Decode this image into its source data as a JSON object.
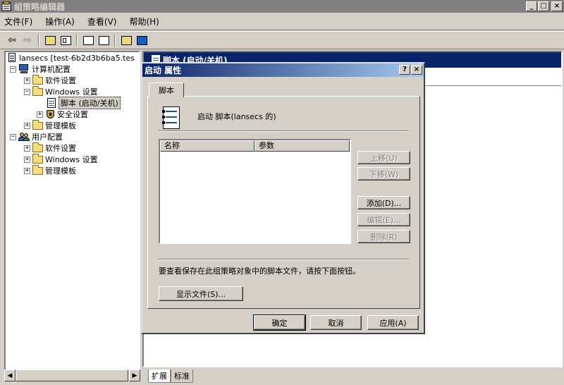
{
  "window": {
    "title": "組策略编辑器",
    "min": "_",
    "max": "□",
    "close": "×"
  },
  "menu": [
    "文件(F)",
    "操作(A)",
    "查看(V)",
    "帮助(H)"
  ],
  "toolbar_icons": [
    "back-arrow",
    "forward-arrow",
    "up-folder",
    "show-hide-tree",
    "properties",
    "export-list",
    "help",
    "console-view"
  ],
  "tree": {
    "root": "lansecs [test-6b2d3b6ba5.tes",
    "computer_config": "计算机配置",
    "software_settings": "软件设置",
    "windows_settings": "Windows 设置",
    "scripts_startup_shutdown": "脚本 (启动/关机)",
    "security_settings": "安全设置",
    "admin_templates": "管理模板",
    "user_config": "用户配置",
    "user_software_settings": "软件设置",
    "user_windows_settings": "Windows 设置",
    "user_admin_templates": "管理模板",
    "expand": "+",
    "collapse": "−"
  },
  "scroll": {
    "left": "◀",
    "right": "▶"
  },
  "right_pane": {
    "header": "脚本 (启动/关机)",
    "tabs": [
      "扩展",
      "标准"
    ]
  },
  "dialog": {
    "title": "启动 属性",
    "help": "?",
    "close": "×",
    "tab": "脚本",
    "panel_title": "启动 脚本(lansecs 的)",
    "columns": [
      "名称",
      "参数"
    ],
    "side_buttons": {
      "up": "上移(U)",
      "down": "下移(W)",
      "add": "添加(D)...",
      "edit": "编辑(E)...",
      "remove": "删除(R)"
    },
    "info": "要查看保存在此组策略对象中的脚本文件，请按下面按钮。",
    "show_files": "显示文件(S)...",
    "ok": "确定",
    "cancel": "取消",
    "apply": "应用(A)"
  }
}
